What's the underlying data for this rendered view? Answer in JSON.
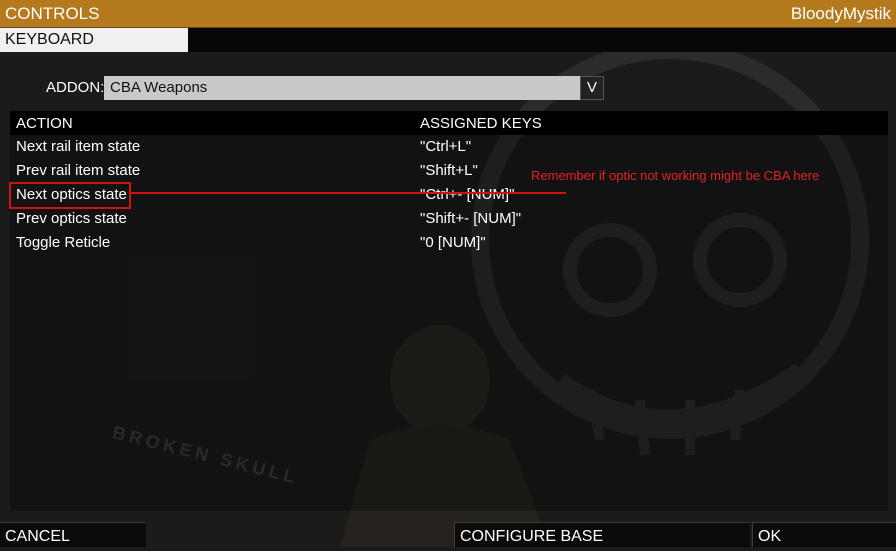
{
  "window": {
    "title": "CONTROLS",
    "user": "BloodyMystik"
  },
  "tabs": [
    {
      "label": "KEYBOARD"
    }
  ],
  "addon": {
    "label": "ADDON:",
    "selected": "CBA Weapons"
  },
  "table": {
    "headers": {
      "action": "ACTION",
      "keys": "ASSIGNED KEYS"
    },
    "rows": [
      {
        "action": "Next rail item state",
        "keys": "\"Ctrl+L\""
      },
      {
        "action": "Prev rail item state",
        "keys": "\"Shift+L\""
      },
      {
        "action": "Next optics state",
        "keys": "\"Ctrl+- [NUM]\""
      },
      {
        "action": "Prev optics state",
        "keys": "\"Shift+- [NUM]\""
      },
      {
        "action": "Toggle Reticle",
        "keys": "\"0 [NUM]\""
      }
    ]
  },
  "annotation": {
    "text": "Remember if optic not working might be CBA here",
    "color": "#d11212"
  },
  "background": {
    "emblem_text": "BROKEN SKULL"
  },
  "footer": {
    "cancel": "CANCEL",
    "configure_base": "CONFIGURE BASE",
    "ok": "OK"
  },
  "colors": {
    "title_bar": "#b57a1e",
    "tab_active": "#f0f0f0",
    "select_bg": "#c9c9c9"
  },
  "icons": {
    "dropdown": "chevron-down-icon"
  }
}
